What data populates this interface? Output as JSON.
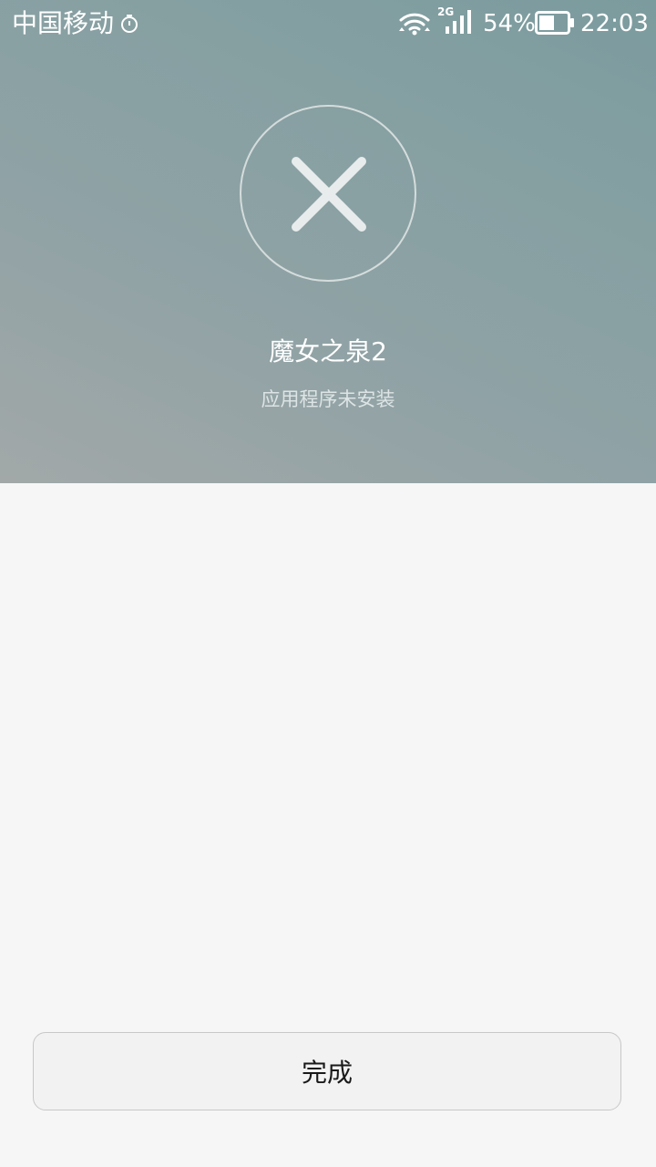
{
  "status_bar": {
    "carrier": "中国移动",
    "network_type": "2G",
    "battery_percent": "54%",
    "battery_level": 0.54,
    "time": "22:03"
  },
  "result": {
    "icon": "close-icon",
    "app_name": "魔女之泉2",
    "message": "应用程序未安装"
  },
  "footer": {
    "done_label": "完成"
  },
  "colors": {
    "header_gradient_start": "#a2a8a8",
    "header_gradient_end": "#7b9b9e",
    "page_background": "#f6f6f6",
    "button_background": "#f2f2f2"
  }
}
